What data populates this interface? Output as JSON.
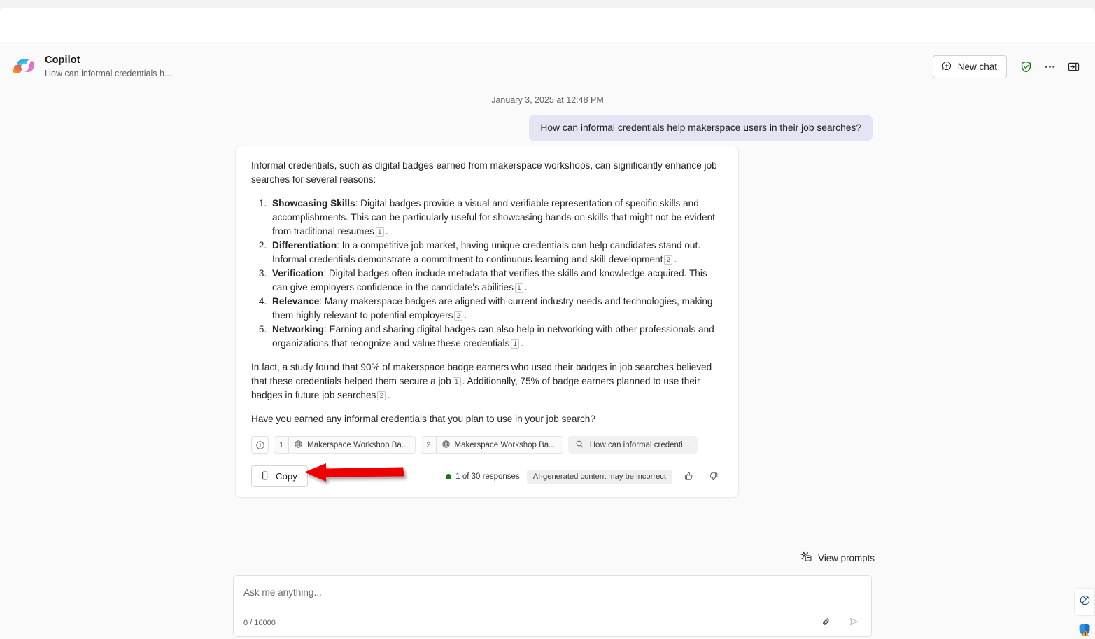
{
  "header": {
    "logo_icon": "copilot-logo",
    "title": "Copilot",
    "subtitle": "How can informal credentials h...",
    "new_chat_label": "New chat",
    "new_chat_icon": "plus-circle-icon",
    "shield_icon": "shield-check-icon",
    "more_icon": "more-horizontal-icon",
    "panel_icon": "collapse-panel-icon"
  },
  "conversation": {
    "timestamp": "January 3, 2025 at 12:48 PM",
    "user_message": "How can informal credentials help makerspace users in their job searches?",
    "response": {
      "intro": "Informal credentials, such as digital badges earned from makerspace workshops, can significantly enhance job searches for several reasons:",
      "list": [
        {
          "term": "Showcasing Skills",
          "body_before": ": Digital badges provide a visual and verifiable representation of specific skills and accomplishments. This can be particularly useful for showcasing hands-on skills that might not be evident from traditional resumes",
          "cite": "1",
          "body_after": "."
        },
        {
          "term": "Differentiation",
          "body_before": ": In a competitive job market, having unique credentials can help candidates stand out. Informal credentials demonstrate a commitment to continuous learning and skill development",
          "cite": "2",
          "body_after": "."
        },
        {
          "term": "Verification",
          "body_before": ": Digital badges often include metadata that verifies the skills and knowledge acquired. This can give employers confidence in the candidate's abilities",
          "cite": "1",
          "body_after": "."
        },
        {
          "term": "Relevance",
          "body_before": ": Many makerspace badges are aligned with current industry needs and technologies, making them highly relevant to potential employers",
          "cite": "2",
          "body_after": "."
        },
        {
          "term": "Networking",
          "body_before": ": Earning and sharing digital badges can also help in networking with other professionals and organizations that recognize and value these credentials",
          "cite": "1",
          "body_after": "."
        }
      ],
      "stat_part1": "In fact, a study found that 90% of makerspace badge earners who used their badges in job searches believed that these credentials helped them secure a job",
      "stat_cite1": "1",
      "stat_part2": ". Additionally, 75% of badge earners planned to use their badges in future job searches",
      "stat_cite2": "2",
      "stat_part3": ".",
      "closing": "Have you earned any informal credentials that you plan to use in your job search?"
    },
    "citations": {
      "info_icon": "info-circle-icon",
      "items": [
        {
          "number": "1",
          "icon": "globe-icon",
          "label": "Makerspace Workshop Ba..."
        },
        {
          "number": "2",
          "icon": "globe-icon",
          "label": "Makerspace Workshop Ba..."
        }
      ],
      "search_pill": {
        "icon": "search-icon",
        "label": "How can informal credenti..."
      }
    },
    "actions": {
      "copy_label": "Copy",
      "copy_icon": "copy-icon",
      "response_count": "1 of 30 responses",
      "status_color": "#107c10",
      "ai_disclaimer": "AI-generated content may be incorrect",
      "thumbs_up_icon": "thumbs-up-icon",
      "thumbs_down_icon": "thumbs-down-icon"
    }
  },
  "compose": {
    "view_prompts_label": "View prompts",
    "view_prompts_icon": "sparkle-prompts-icon",
    "placeholder": "Ask me anything...",
    "char_count": "0 / 16000",
    "attach_icon": "paperclip-icon",
    "send_icon": "send-icon"
  },
  "rail": {
    "browser_icon": "globe-browser-icon",
    "shield_icon": "shield-warning-icon"
  },
  "annotation": {
    "arrow_color": "#ee0000",
    "arrow_direction": "left"
  }
}
